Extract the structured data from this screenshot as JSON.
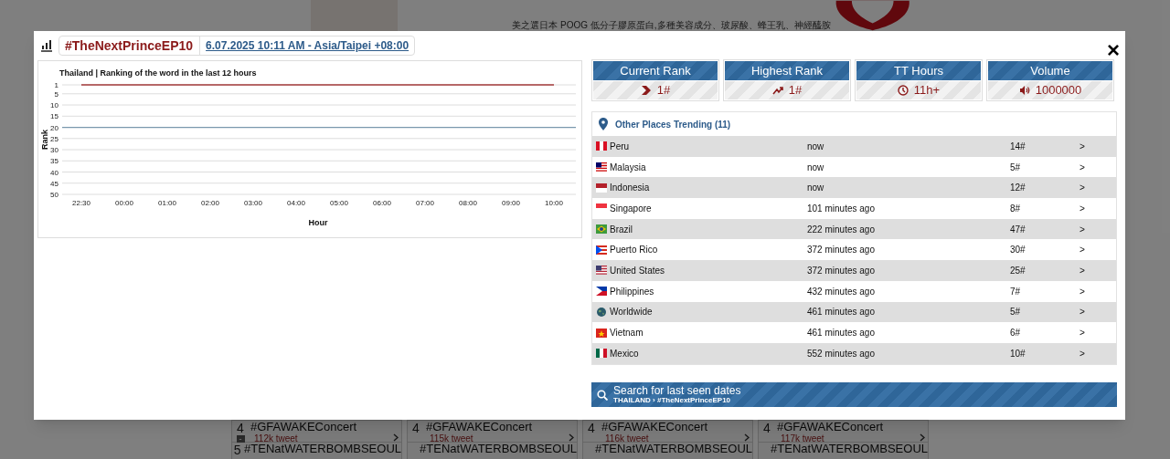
{
  "background_page": {
    "ad": {
      "description": "美之選日本 POOG 低分子膠原蛋白,多種美容成分、玻尿酸、蜂王乳、神經醯胺"
    },
    "cards": [
      {
        "rows": [
          {
            "rank": "4",
            "tag": "#GFAWAKEConcert",
            "count": "112k tweet",
            "badge": "-"
          },
          {
            "rank": "5",
            "tag": "#TENatWATERBOMBSEOUL"
          }
        ]
      },
      {
        "rows": [
          {
            "rank": "4",
            "tag": "#GFAWAKEConcert",
            "count": "115k tweet"
          },
          {
            "tag": "#TENatWATERBOMBSEOUL"
          }
        ]
      },
      {
        "rows": [
          {
            "rank": "4",
            "tag": "#GFAWAKEConcert",
            "count": "116k tweet"
          },
          {
            "tag": "#TENatWATERBOMBSEOUL"
          }
        ]
      },
      {
        "rows": [
          {
            "rank": "4",
            "tag": "#GFAWAKEConcert",
            "count": "117k tweet"
          },
          {
            "tag": "#TENatWATERBOMBSEOUL"
          }
        ]
      }
    ]
  },
  "modal": {
    "hashtag": "#TheNextPrinceEP10",
    "date_link": "6.07.2025 10:11 AM - Asia/Taipei +08:00",
    "close": "×",
    "chart": {
      "chart_data": {
        "type": "line",
        "title": "Thailand | Ranking of the word in the last 12 hours",
        "xlabel": "Hour",
        "ylabel": "Rank",
        "categories": [
          "22:30",
          "00:00",
          "01:00",
          "02:00",
          "03:00",
          "04:00",
          "05:00",
          "06:00",
          "07:00",
          "08:00",
          "09:00",
          "10:00"
        ],
        "series": [
          {
            "color": "#a33a3a",
            "values": [
              1,
              1,
              1,
              1,
              1,
              1,
              1,
              1,
              1,
              1,
              1,
              1
            ]
          }
        ],
        "ylim": [
          50,
          1
        ],
        "yticks": [
          1,
          5,
          10,
          15,
          20,
          25,
          30,
          35,
          40,
          45,
          50
        ],
        "grid": true,
        "ref_lines": [
          {
            "axis": "y",
            "value": 20,
            "color": "#7a98ad"
          }
        ]
      }
    },
    "stats": [
      {
        "kind": "chevron",
        "label": "Current Rank",
        "value": "1#"
      },
      {
        "kind": "trend",
        "label": "Highest Rank",
        "value": "1#"
      },
      {
        "kind": "clock",
        "label": "TT Hours",
        "value": "11h+"
      },
      {
        "kind": "speaker",
        "label": "Volume",
        "value": "1000000"
      }
    ],
    "other_places": {
      "title": "Other Places Trending (11)",
      "rows": [
        {
          "kind": "pe",
          "place": "Peru",
          "time": "now",
          "rank": "14#",
          "arrow": ">"
        },
        {
          "kind": "my",
          "place": "Malaysia",
          "time": "now",
          "rank": "5#",
          "arrow": ">"
        },
        {
          "kind": "id",
          "place": "Indonesia",
          "time": "now",
          "rank": "12#",
          "arrow": ">"
        },
        {
          "kind": "sg",
          "place": "Singapore",
          "time": "101 minutes ago",
          "rank": "8#",
          "arrow": ">"
        },
        {
          "kind": "br",
          "place": "Brazil",
          "time": "222 minutes ago",
          "rank": "47#",
          "arrow": ">"
        },
        {
          "kind": "pr",
          "place": "Puerto Rico",
          "time": "372 minutes ago",
          "rank": "30#",
          "arrow": ">"
        },
        {
          "kind": "us",
          "place": "United States",
          "time": "372 minutes ago",
          "rank": "25#",
          "arrow": ">"
        },
        {
          "kind": "ph",
          "place": "Philippines",
          "time": "432 minutes ago",
          "rank": "7#",
          "arrow": ">"
        },
        {
          "kind": "ww",
          "place": "Worldwide",
          "time": "461 minutes ago",
          "rank": "5#",
          "arrow": ">"
        },
        {
          "kind": "vn",
          "place": "Vietnam",
          "time": "461 minutes ago",
          "rank": "6#",
          "arrow": ">"
        },
        {
          "kind": "mx",
          "place": "Mexico",
          "time": "552 minutes ago",
          "rank": "10#",
          "arrow": ">"
        }
      ]
    },
    "search": {
      "title": "Search for last seen dates",
      "breadcrumb": "THAILAND › #TheNextPrinceEP10"
    }
  }
}
